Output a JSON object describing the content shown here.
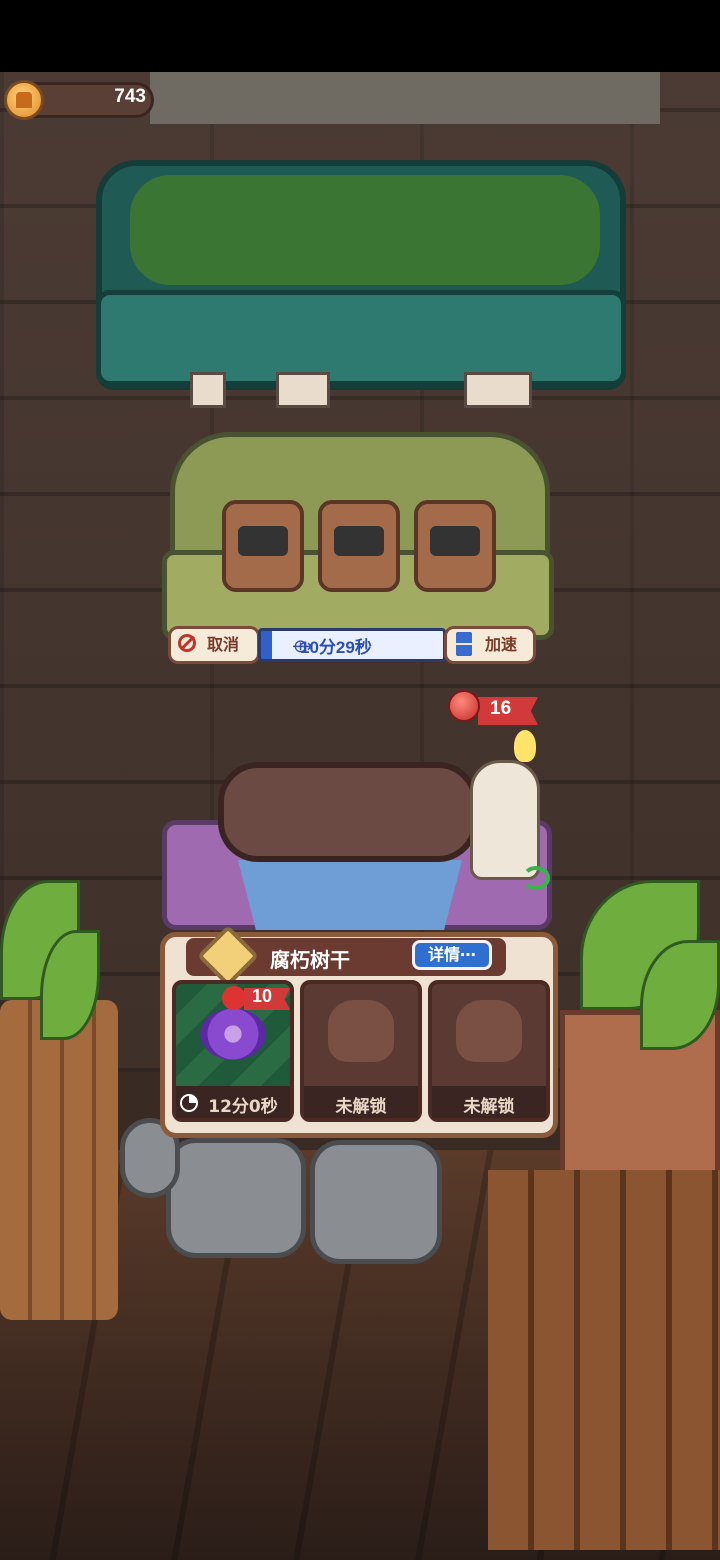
{
  "currency": {
    "icon": "house-coin-icon",
    "value": "743"
  },
  "furnace": {
    "cancel_label": "取消",
    "timer": "10分29秒",
    "speedup_label": "加速"
  },
  "station": {
    "apple_count": "16"
  },
  "panel": {
    "title": "腐朽树干",
    "detail_label": "详情⋯",
    "slots": [
      {
        "apple_count": "10",
        "label": "12分0秒",
        "state": "unlocked"
      },
      {
        "label": "未解锁",
        "state": "locked"
      },
      {
        "label": "未解锁",
        "state": "locked"
      }
    ]
  }
}
